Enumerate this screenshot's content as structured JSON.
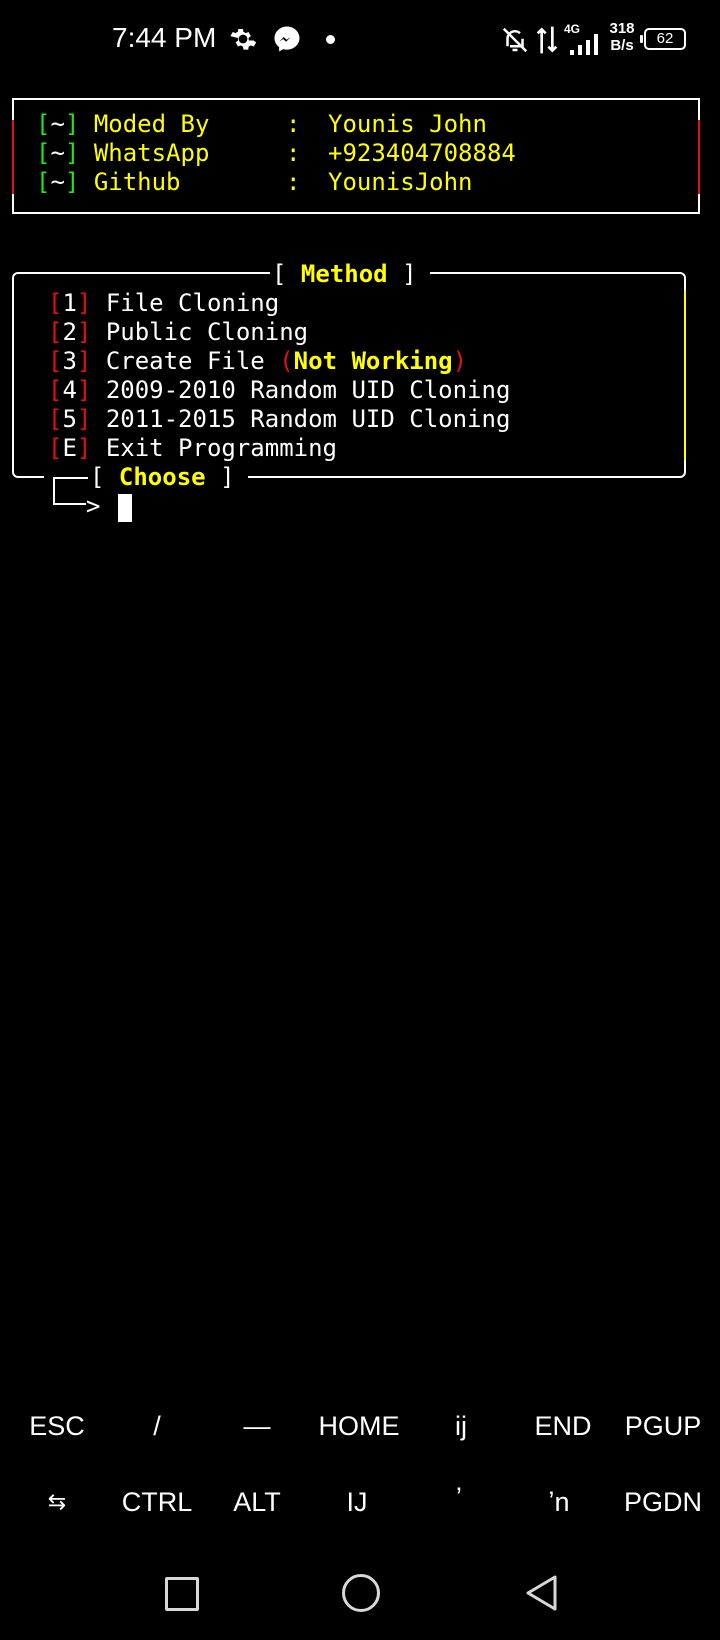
{
  "status_bar": {
    "time": "7:44 PM",
    "network_type": "4G",
    "speed_value": "318",
    "speed_unit": "B/s",
    "battery": "62",
    "icons": [
      "gear-icon",
      "messenger-icon",
      "dot-icon",
      "bell-off-icon",
      "data-updown-icon",
      "signal-icon",
      "battery-icon"
    ]
  },
  "banner": {
    "rows": [
      {
        "prefix_open": "[",
        "prefix_mid": "~",
        "prefix_close": "]",
        "label": "Moded By",
        "sep": ":",
        "value": "Younis John"
      },
      {
        "prefix_open": "[",
        "prefix_mid": "~",
        "prefix_close": "]",
        "label": "WhatsApp",
        "sep": ":",
        "value": "+923404708884"
      },
      {
        "prefix_open": "[",
        "prefix_mid": "~",
        "prefix_close": "]",
        "label": "Github",
        "sep": ":",
        "value": "YounisJohn"
      }
    ]
  },
  "method_box": {
    "title_open": "[",
    "title": "Method",
    "title_close": "]",
    "items": [
      {
        "key": "1",
        "label": "File Cloning"
      },
      {
        "key": "2",
        "label": "Public Cloning"
      },
      {
        "key": "3",
        "label": "Create File",
        "note_open": "(",
        "note": "Not Working",
        "note_close": ")"
      },
      {
        "key": "4",
        "label": "2009-2010 Random UID Cloning"
      },
      {
        "key": "5",
        "label": "2011-2015 Random UID Cloning"
      },
      {
        "key": "E",
        "label": "Exit Programming"
      }
    ],
    "choose_open": "[",
    "choose": "Choose",
    "choose_close": "]",
    "arrow": "└──>"
  },
  "extra_keys": {
    "row1": [
      "ESC",
      "/",
      "—",
      "HOME",
      "ij",
      "END",
      "PGUP"
    ],
    "row2": [
      "⇆",
      "CTRL",
      "ALT",
      "IJ",
      "ʼ",
      "ʼn",
      "PGDN"
    ]
  },
  "colors": {
    "yellow": "#ffff00",
    "green": "#22e51d",
    "red": "#e01212",
    "background": "#000000"
  }
}
